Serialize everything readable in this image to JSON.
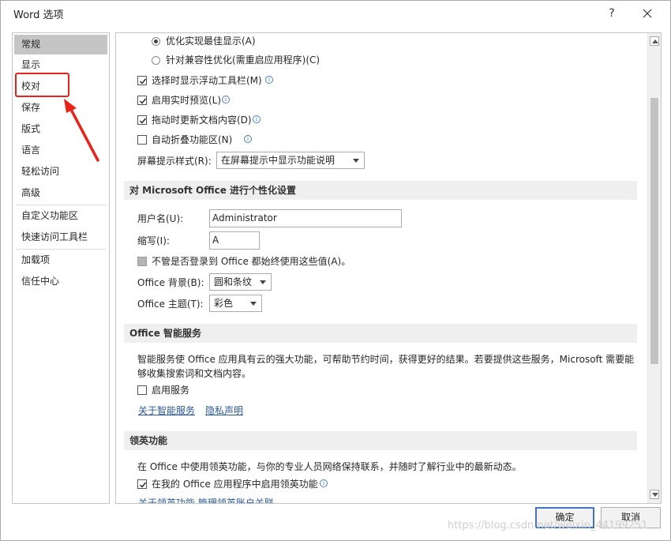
{
  "window": {
    "title": "Word 选项",
    "help_label": "?",
    "close_icon": "close-icon"
  },
  "nav": {
    "items": [
      {
        "label": "常规",
        "selected": true
      },
      {
        "label": "显示"
      },
      {
        "label": "校对"
      },
      {
        "label": "保存"
      },
      {
        "label": "版式"
      },
      {
        "label": "语言"
      },
      {
        "label": "轻松访问"
      },
      {
        "label": "高级"
      },
      {
        "label": "自定义功能区"
      },
      {
        "label": "快速访问工具栏"
      },
      {
        "label": "加载项"
      },
      {
        "label": "信任中心"
      }
    ]
  },
  "ui_options": {
    "radio_best_display": "优化实现最佳显示(A)",
    "radio_compat": "针对兼容性优化(需重启应用程序)(C)",
    "mini_toolbar": "选择时显示浮动工具栏(M)",
    "live_preview": "启用实时预览(L)",
    "update_on_drag": "拖动时更新文档内容(D)",
    "collapse_ribbon": "自动折叠功能区(N)",
    "screentip_label": "屏幕提示样式(R):",
    "screentip_value": "在屏幕提示中显示功能说明"
  },
  "personalize": {
    "heading": "对 Microsoft Office 进行个性化设置",
    "username_label": "用户名(U):",
    "username_value": "Administrator",
    "initials_label": "缩写(I):",
    "initials_value": "A",
    "always_use": "不管是否登录到 Office 都始终使用这些值(A)。",
    "background_label": "Office 背景(B):",
    "background_value": "圆和条纹",
    "theme_label": "Office 主题(T):",
    "theme_value": "彩色"
  },
  "intelligent": {
    "heading": "Office 智能服务",
    "description": "智能服务使 Office 应用具有云的强大功能，可帮助节约时间，获得更好的结果。若要提供这些服务，Microsoft 需要能够收集搜索词和文档内容。",
    "enable": "启用服务",
    "about_link": "关于智能服务",
    "privacy_link": "隐私声明"
  },
  "linkedin": {
    "heading": "领英功能",
    "description": "在 Office 中使用领英功能，与你的专业人员网络保持联系，并随时了解行业中的最新动态。",
    "enable": "在我的 Office 应用程序中启用领英功能",
    "cut_links": "关于领英功能  管理领英账户关联"
  },
  "footer": {
    "ok": "确定",
    "cancel": "取消"
  },
  "watermark": "https://blog.csdn.net/weixin_44199251",
  "colors": {
    "annotation": "#e8231a",
    "link": "#2b5797",
    "selected_nav": "#c5c5c5",
    "section_header": "#efefef"
  }
}
